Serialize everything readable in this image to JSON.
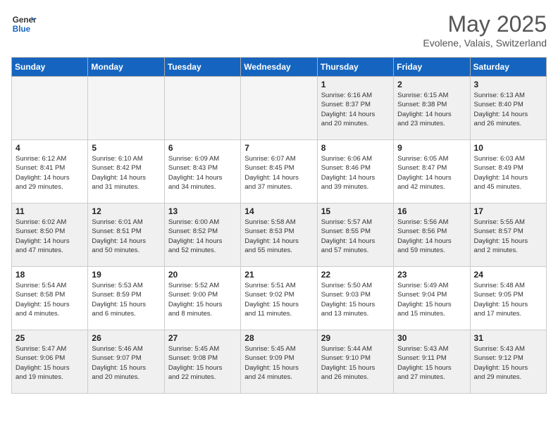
{
  "header": {
    "logo_line1": "General",
    "logo_line2": "Blue",
    "month": "May 2025",
    "location": "Evolene, Valais, Switzerland"
  },
  "days_of_week": [
    "Sunday",
    "Monday",
    "Tuesday",
    "Wednesday",
    "Thursday",
    "Friday",
    "Saturday"
  ],
  "weeks": [
    [
      {
        "day": "",
        "empty": true
      },
      {
        "day": "",
        "empty": true
      },
      {
        "day": "",
        "empty": true
      },
      {
        "day": "",
        "empty": true
      },
      {
        "day": "1",
        "lines": [
          "Sunrise: 6:16 AM",
          "Sunset: 8:37 PM",
          "Daylight: 14 hours",
          "and 20 minutes."
        ]
      },
      {
        "day": "2",
        "lines": [
          "Sunrise: 6:15 AM",
          "Sunset: 8:38 PM",
          "Daylight: 14 hours",
          "and 23 minutes."
        ]
      },
      {
        "day": "3",
        "lines": [
          "Sunrise: 6:13 AM",
          "Sunset: 8:40 PM",
          "Daylight: 14 hours",
          "and 26 minutes."
        ]
      }
    ],
    [
      {
        "day": "4",
        "lines": [
          "Sunrise: 6:12 AM",
          "Sunset: 8:41 PM",
          "Daylight: 14 hours",
          "and 29 minutes."
        ]
      },
      {
        "day": "5",
        "lines": [
          "Sunrise: 6:10 AM",
          "Sunset: 8:42 PM",
          "Daylight: 14 hours",
          "and 31 minutes."
        ]
      },
      {
        "day": "6",
        "lines": [
          "Sunrise: 6:09 AM",
          "Sunset: 8:43 PM",
          "Daylight: 14 hours",
          "and 34 minutes."
        ]
      },
      {
        "day": "7",
        "lines": [
          "Sunrise: 6:07 AM",
          "Sunset: 8:45 PM",
          "Daylight: 14 hours",
          "and 37 minutes."
        ]
      },
      {
        "day": "8",
        "lines": [
          "Sunrise: 6:06 AM",
          "Sunset: 8:46 PM",
          "Daylight: 14 hours",
          "and 39 minutes."
        ]
      },
      {
        "day": "9",
        "lines": [
          "Sunrise: 6:05 AM",
          "Sunset: 8:47 PM",
          "Daylight: 14 hours",
          "and 42 minutes."
        ]
      },
      {
        "day": "10",
        "lines": [
          "Sunrise: 6:03 AM",
          "Sunset: 8:49 PM",
          "Daylight: 14 hours",
          "and 45 minutes."
        ]
      }
    ],
    [
      {
        "day": "11",
        "lines": [
          "Sunrise: 6:02 AM",
          "Sunset: 8:50 PM",
          "Daylight: 14 hours",
          "and 47 minutes."
        ]
      },
      {
        "day": "12",
        "lines": [
          "Sunrise: 6:01 AM",
          "Sunset: 8:51 PM",
          "Daylight: 14 hours",
          "and 50 minutes."
        ]
      },
      {
        "day": "13",
        "lines": [
          "Sunrise: 6:00 AM",
          "Sunset: 8:52 PM",
          "Daylight: 14 hours",
          "and 52 minutes."
        ]
      },
      {
        "day": "14",
        "lines": [
          "Sunrise: 5:58 AM",
          "Sunset: 8:53 PM",
          "Daylight: 14 hours",
          "and 55 minutes."
        ]
      },
      {
        "day": "15",
        "lines": [
          "Sunrise: 5:57 AM",
          "Sunset: 8:55 PM",
          "Daylight: 14 hours",
          "and 57 minutes."
        ]
      },
      {
        "day": "16",
        "lines": [
          "Sunrise: 5:56 AM",
          "Sunset: 8:56 PM",
          "Daylight: 14 hours",
          "and 59 minutes."
        ]
      },
      {
        "day": "17",
        "lines": [
          "Sunrise: 5:55 AM",
          "Sunset: 8:57 PM",
          "Daylight: 15 hours",
          "and 2 minutes."
        ]
      }
    ],
    [
      {
        "day": "18",
        "lines": [
          "Sunrise: 5:54 AM",
          "Sunset: 8:58 PM",
          "Daylight: 15 hours",
          "and 4 minutes."
        ]
      },
      {
        "day": "19",
        "lines": [
          "Sunrise: 5:53 AM",
          "Sunset: 8:59 PM",
          "Daylight: 15 hours",
          "and 6 minutes."
        ]
      },
      {
        "day": "20",
        "lines": [
          "Sunrise: 5:52 AM",
          "Sunset: 9:00 PM",
          "Daylight: 15 hours",
          "and 8 minutes."
        ]
      },
      {
        "day": "21",
        "lines": [
          "Sunrise: 5:51 AM",
          "Sunset: 9:02 PM",
          "Daylight: 15 hours",
          "and 11 minutes."
        ]
      },
      {
        "day": "22",
        "lines": [
          "Sunrise: 5:50 AM",
          "Sunset: 9:03 PM",
          "Daylight: 15 hours",
          "and 13 minutes."
        ]
      },
      {
        "day": "23",
        "lines": [
          "Sunrise: 5:49 AM",
          "Sunset: 9:04 PM",
          "Daylight: 15 hours",
          "and 15 minutes."
        ]
      },
      {
        "day": "24",
        "lines": [
          "Sunrise: 5:48 AM",
          "Sunset: 9:05 PM",
          "Daylight: 15 hours",
          "and 17 minutes."
        ]
      }
    ],
    [
      {
        "day": "25",
        "lines": [
          "Sunrise: 5:47 AM",
          "Sunset: 9:06 PM",
          "Daylight: 15 hours",
          "and 19 minutes."
        ]
      },
      {
        "day": "26",
        "lines": [
          "Sunrise: 5:46 AM",
          "Sunset: 9:07 PM",
          "Daylight: 15 hours",
          "and 20 minutes."
        ]
      },
      {
        "day": "27",
        "lines": [
          "Sunrise: 5:45 AM",
          "Sunset: 9:08 PM",
          "Daylight: 15 hours",
          "and 22 minutes."
        ]
      },
      {
        "day": "28",
        "lines": [
          "Sunrise: 5:45 AM",
          "Sunset: 9:09 PM",
          "Daylight: 15 hours",
          "and 24 minutes."
        ]
      },
      {
        "day": "29",
        "lines": [
          "Sunrise: 5:44 AM",
          "Sunset: 9:10 PM",
          "Daylight: 15 hours",
          "and 26 minutes."
        ]
      },
      {
        "day": "30",
        "lines": [
          "Sunrise: 5:43 AM",
          "Sunset: 9:11 PM",
          "Daylight: 15 hours",
          "and 27 minutes."
        ]
      },
      {
        "day": "31",
        "lines": [
          "Sunrise: 5:43 AM",
          "Sunset: 9:12 PM",
          "Daylight: 15 hours",
          "and 29 minutes."
        ]
      }
    ]
  ]
}
